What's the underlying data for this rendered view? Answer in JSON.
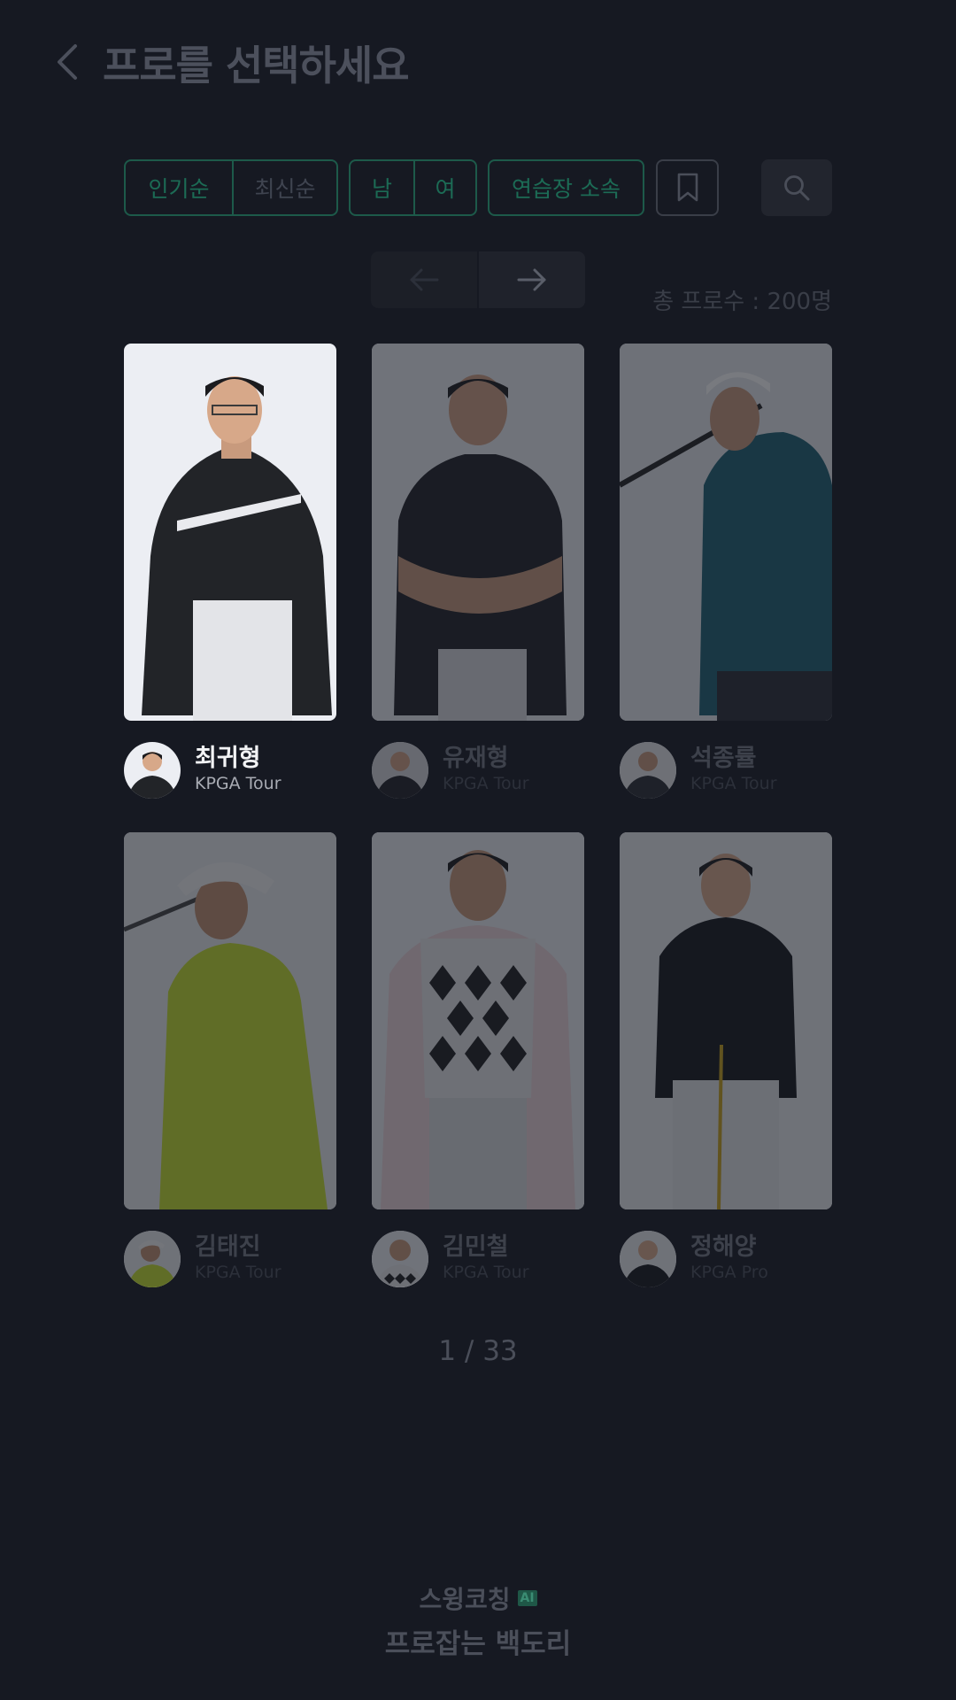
{
  "header": {
    "title": "프로를 선택하세요"
  },
  "filters": {
    "sort": [
      {
        "label": "인기순",
        "active": true
      },
      {
        "label": "최신순",
        "active": false
      }
    ],
    "gender": [
      {
        "label": "남",
        "active": true
      },
      {
        "label": "여",
        "active": true
      }
    ],
    "affiliation": {
      "label": "연습장 소속",
      "active": true
    }
  },
  "total_count": "총 프로수 : 200명",
  "pros": [
    {
      "name": "최귀형",
      "tour": "KPGA Tour",
      "selected": true
    },
    {
      "name": "유재형",
      "tour": "KPGA Tour",
      "selected": false
    },
    {
      "name": "석종률",
      "tour": "KPGA Tour",
      "selected": false
    },
    {
      "name": "김태진",
      "tour": "KPGA Tour",
      "selected": false
    },
    {
      "name": "김민철",
      "tour": "KPGA Tour",
      "selected": false
    },
    {
      "name": "정해양",
      "tour": "KPGA Pro",
      "selected": false
    }
  ],
  "pagination": {
    "indicator": "1 / 33"
  },
  "brand": {
    "line1": "스윙코칭",
    "badge": "AI",
    "line2": "프로잡는 백도리"
  },
  "colors": {
    "background": "#161922",
    "accent_green": "#1c6b55",
    "selected_text": "#f2f3f5"
  }
}
